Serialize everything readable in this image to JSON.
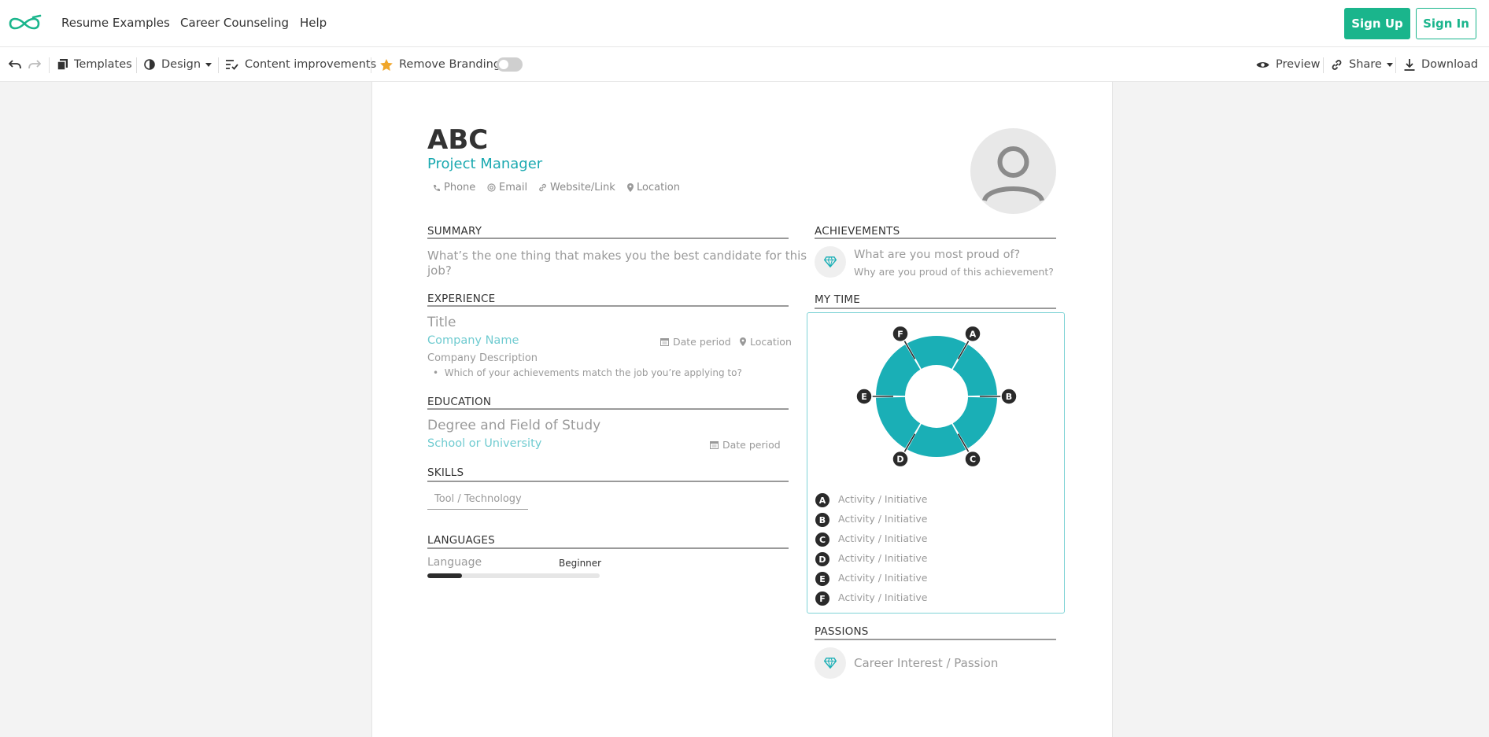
{
  "nav": {
    "links": [
      "Resume Examples",
      "Career Counseling",
      "Help"
    ],
    "signup": "Sign Up",
    "signin": "Sign In"
  },
  "toolbar": {
    "templates": "Templates",
    "design": "Design",
    "content": "Content improvements",
    "branding": "Remove Branding",
    "preview": "Preview",
    "share": "Share",
    "download": "Download"
  },
  "resume": {
    "name": "ABC",
    "title": "Project Manager",
    "contacts": [
      "Phone",
      "Email",
      "Website/Link",
      "Location"
    ],
    "summary": {
      "heading": "SUMMARY",
      "line1": "What’s the one thing that makes you the best candidate for this",
      "line2": "job?"
    },
    "experience": {
      "heading": "EXPERIENCE",
      "title": "Title",
      "company": "Company Name",
      "date": "Date period",
      "location": "Location",
      "description": "Company Description",
      "bullet": "Which of your achievements match the job you’re applying to?"
    },
    "education": {
      "heading": "EDUCATION",
      "degree": "Degree and Field of Study",
      "school": "School or University",
      "date": "Date period"
    },
    "skills": {
      "heading": "SKILLS",
      "item": "Tool / Technology"
    },
    "languages": {
      "heading": "LANGUAGES",
      "name": "Language",
      "level": "Beginner",
      "level_fraction": 0.2
    },
    "achievements": {
      "heading": "ACHIEVEMENTS",
      "question": "What are you most proud of?",
      "sub": "Why are you proud of this achievement?"
    },
    "mytime": {
      "heading": "MY TIME",
      "segments": [
        {
          "letter": "A",
          "label": "Activity / Initiative"
        },
        {
          "letter": "B",
          "label": "Activity / Initiative"
        },
        {
          "letter": "C",
          "label": "Activity / Initiative"
        },
        {
          "letter": "D",
          "label": "Activity / Initiative"
        },
        {
          "letter": "E",
          "label": "Activity / Initiative"
        },
        {
          "letter": "F",
          "label": "Activity / Initiative"
        }
      ],
      "color": "#1aafb6"
    },
    "passions": {
      "heading": "PASSIONS",
      "item": "Career Interest / Passion"
    }
  }
}
